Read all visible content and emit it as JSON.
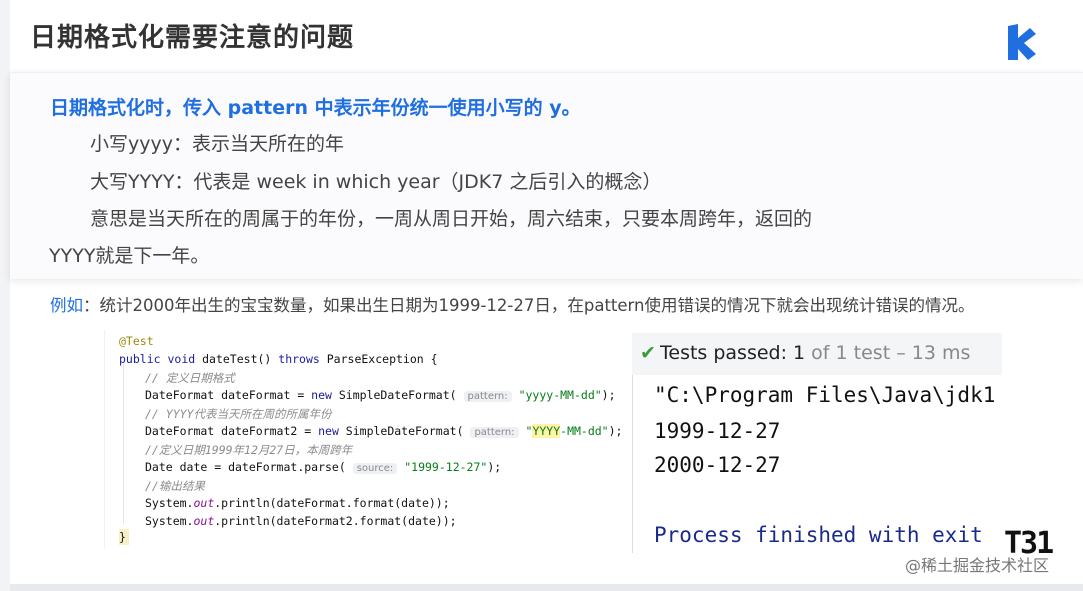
{
  "title": "日期格式化需要注意的问题",
  "logo": {
    "icon": "k-logo-icon",
    "color": "#1f6fe0"
  },
  "callout": {
    "headline": "日期格式化时，传入 pattern 中表示年份统一使用小写的 y。",
    "line1": "小写yyyy：表示当天所在的年",
    "line2": "大写YYYY：代表是 week in which year（JDK7 之后引入的概念）",
    "line3": "意思是当天所在的周属于的年份，一周从周日开始，周六结束，只要本周跨年，返回的",
    "line4": "YYYY就是下一年。"
  },
  "example": {
    "keyword": "例如",
    "text": "：统计2000年出生的宝宝数量，如果出生日期为1999-12-27日，在pattern使用错误的情况下就会出现统计错误的情况。"
  },
  "code": {
    "annotation": "@Test",
    "kw_public": "public",
    "kw_void": "void",
    "method_sig": " dateTest() ",
    "kw_throws": "throws",
    "exception": " ParseException {",
    "comment1": "// 定义日期格式",
    "l_df_a": "DateFormat dateFormat = ",
    "kw_new": "new",
    "l_df_b": " SimpleDateFormat( ",
    "hint_pattern": "pattern:",
    "str_yyyy": "\"yyyy-MM-dd\"",
    "l_end": ");",
    "comment2": "// YYYY代表当天所在周的所属年份",
    "l_df2_a": "DateFormat dateFormat2 = ",
    "str_YYYY_q": "\"",
    "str_YYYY": "YYYY",
    "str_YYYY_rest": "-MM-dd\"",
    "comment3": "//定义日期1999年12月27日，本周跨年",
    "l_date_a": "Date date = dateFormat.parse( ",
    "hint_source": "source:",
    "str_date": "\"1999-12-27\"",
    "comment4": "//输出结果",
    "sys": "System.",
    "out": "out",
    "println1": ".println(dateFormat.format(date));",
    "println2": ".println(dateFormat2.format(date));",
    "close": "}"
  },
  "run": {
    "passed_label": "Tests passed: ",
    "passed_count": "1",
    "passed_rest": " of 1 test – 13 ms",
    "cmd": "\"C:\\Program Files\\Java\\jdk1",
    "out1": "1999-12-27",
    "out2": "2000-12-27",
    "process": "Process finished with exit"
  },
  "watermark": {
    "badge": "T31",
    "site": "@稀土掘金技术社区"
  }
}
